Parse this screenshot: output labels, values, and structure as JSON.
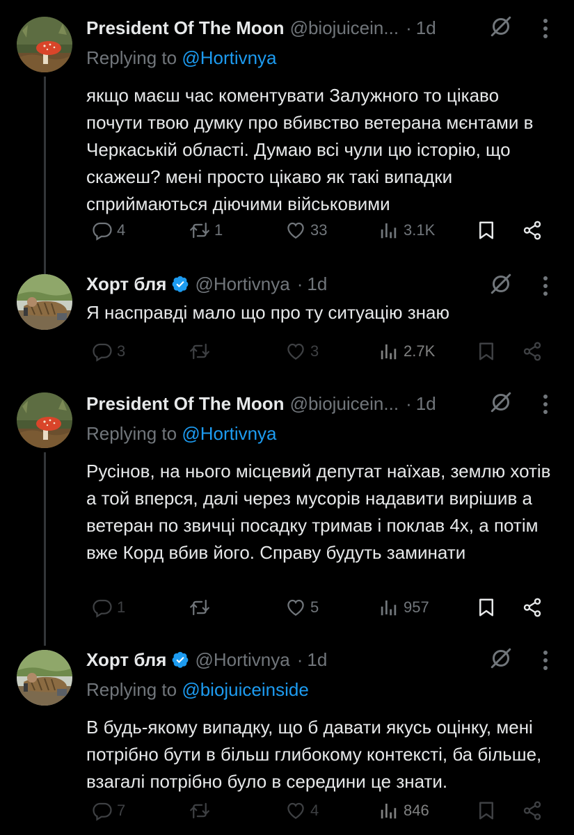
{
  "colors": {
    "background": "#000000",
    "text": "#e7e9ea",
    "muted": "#71767b",
    "link": "#1d9bf0",
    "verified": "#1d9bf0"
  },
  "tweets": [
    {
      "name": "President Of The Moon",
      "handle": "@biojuicein...",
      "time": "1d",
      "verified": false,
      "replying_label": "Replying to ",
      "replying_to": "@Hortivnya",
      "text": "якщо маєш час коментувати Залужного то цікаво почути твою думку про вбивство ветерана мєнтами в Черкаській області. Думаю всі чули цю історію, що скажеш? мені просто цікаво як такі випадки сприймаються діючими військовими",
      "replies": "4",
      "retweets": "1",
      "likes": "33",
      "views": "3.1K",
      "avatar_icon": "mushroom-icon"
    },
    {
      "name": "Хорт бля",
      "handle": "@Hortivnya",
      "time": "1d",
      "verified": true,
      "text": "Я насправді мало що про ту ситуацію знаю",
      "replies": "3",
      "retweets": "",
      "likes": "3",
      "views": "2.7K",
      "avatar_icon": "person-photo-icon"
    },
    {
      "name": "President Of The Moon",
      "handle": "@biojuicein...",
      "time": "1d",
      "verified": false,
      "replying_label": "Replying to ",
      "replying_to": "@Hortivnya",
      "text": "Русінов, на нього місцевий депутат наїхав, землю хотів а той вперся, далі через мусорів надавити вирішив а ветеран по звичці посадку тримав і поклав 4х, а потім вже Корд вбив його. Справу будуть заминати",
      "replies": "1",
      "retweets": "",
      "likes": "5",
      "views": "957",
      "avatar_icon": "mushroom-icon"
    },
    {
      "name": "Хорт бля",
      "handle": "@Hortivnya",
      "time": "1d",
      "verified": true,
      "replying_label": "Replying to ",
      "replying_to": "@biojuiceinside",
      "text": "В будь-якому випадку, що б давати якусь оцінку, мені потрібно бути в більш глибокому контексті, ба більше, взагалі потрібно було в середини це знати.",
      "replies": "7",
      "retweets": "",
      "likes": "4",
      "views": "846",
      "avatar_icon": "person-photo-icon"
    }
  ]
}
